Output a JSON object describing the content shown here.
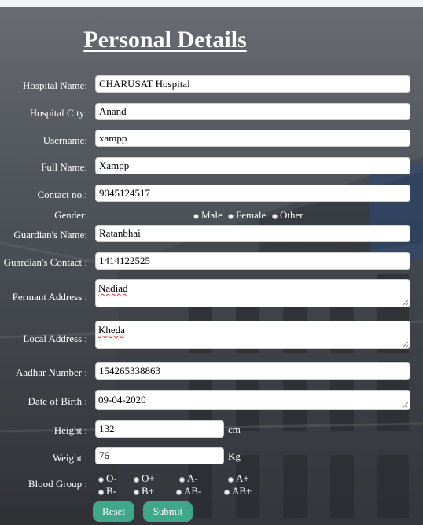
{
  "form": {
    "title": "Personal Details",
    "hospital_name": {
      "label": "Hospital Name:",
      "value": "CHARUSAT Hospital"
    },
    "hospital_city": {
      "label": "Hospital City:",
      "value": "Anand"
    },
    "username": {
      "label": "Username:",
      "value": "xampp"
    },
    "full_name": {
      "label": "Full Name:",
      "value": "Xampp"
    },
    "contact": {
      "label": "Contact no.:",
      "value": "9045124517"
    },
    "gender": {
      "label": "Gender:",
      "options": [
        "Male",
        "Female",
        "Other"
      ]
    },
    "guardian_name": {
      "label": "Guardian's Name:",
      "value": "Ratanbhai"
    },
    "guardian_contact": {
      "label": "Guardian's Contact :",
      "value": "1414122525"
    },
    "permanent_address": {
      "label": "Permant Address :",
      "value": "Nadiad"
    },
    "local_address": {
      "label": "Local Address :",
      "value": "Kheda"
    },
    "aadhar": {
      "label": "Aadhar Number :",
      "value": "154265338863"
    },
    "dob": {
      "label": "Date of Birth :",
      "value": "09-04-2020"
    },
    "height": {
      "label": "Height :",
      "value": "132",
      "unit": "cm"
    },
    "weight": {
      "label": "Weight :",
      "value": "76",
      "unit": "Kg"
    },
    "blood_group": {
      "label": "Blood Group :",
      "options": [
        "O-",
        "O+",
        "A-",
        "A+",
        "B-",
        "B+",
        "AB-",
        "AB+"
      ]
    },
    "reset_label": "Reset",
    "submit_label": "Submit"
  },
  "colors": {
    "button": "#3fa889",
    "topbar": "#f2f3f5"
  }
}
